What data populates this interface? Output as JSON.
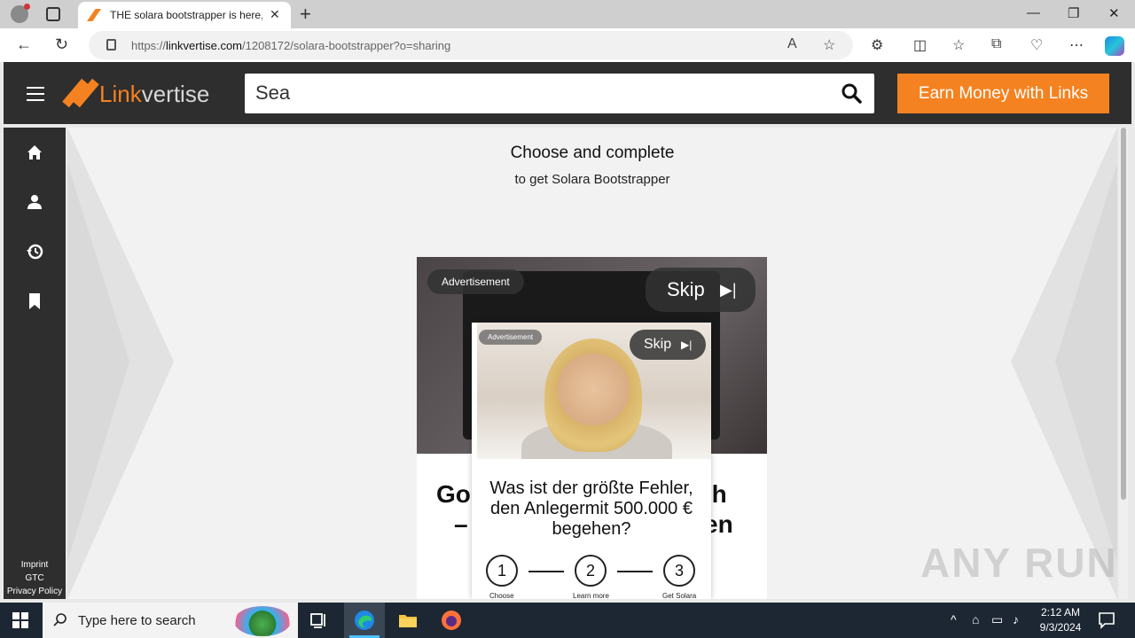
{
  "browser": {
    "tab_title": "THE solara bootstrapper is here, L",
    "url_prefix": "https://",
    "url_domain": "linkvertise.com",
    "url_path": "/1208172/solara-bootstrapper?o=sharing"
  },
  "site": {
    "logo_part1": "Link",
    "logo_part2": "vertise",
    "search_value": "Sea",
    "earn_button": "Earn Money with Links",
    "footer_links": [
      "Imprint",
      "GTC",
      "Privacy Policy"
    ]
  },
  "main": {
    "headline": "Choose and complete",
    "subline": "to get Solara Bootstrapper"
  },
  "ad_outer": {
    "advertisement_label": "Advertisement",
    "skip_label": "Skip",
    "title_left": "Gol",
    "title_right": "och",
    "title_line2_left": "–",
    "title_line2_right": "en"
  },
  "ad_inner": {
    "advertisement_label": "Advertisement",
    "skip_label": "Skip",
    "question": "Was ist der größte Fehler, den Anlegermit 500.000 € begehen?",
    "steps": [
      {
        "num": "1",
        "label": "Choose"
      },
      {
        "num": "2",
        "label": "Learn more"
      },
      {
        "num": "3",
        "label": "Get Solara"
      }
    ]
  },
  "watermark": "ANY RUN",
  "taskbar": {
    "search_placeholder": "Type here to search",
    "time": "2:12 AM",
    "date": "9/3/2024"
  }
}
